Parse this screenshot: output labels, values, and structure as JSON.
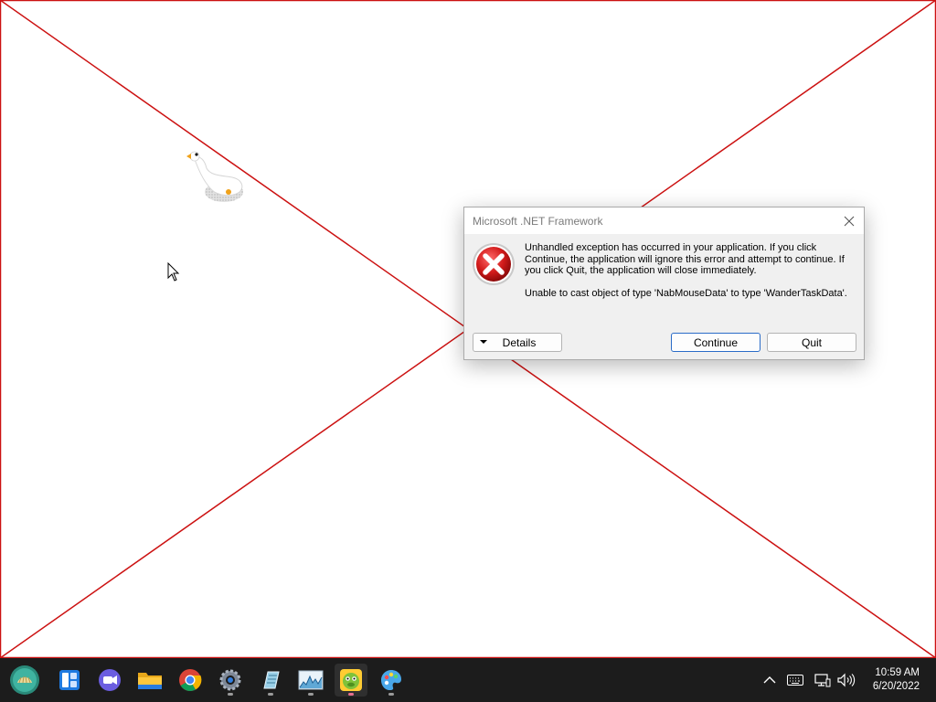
{
  "dialog": {
    "title": "Microsoft .NET Framework",
    "message": "Unhandled exception has occurred in your application. If you click Continue, the application will ignore this error and attempt to continue. If you click Quit, the application will close immediately.",
    "detail": "Unable to cast object of type 'NabMouseData' to type 'WanderTaskData'.",
    "buttons": {
      "details": "Details",
      "continue": "Continue",
      "quit": "Quit"
    },
    "icons": {
      "close": "close-icon",
      "error": "error-icon",
      "expand": "caret-down-icon"
    }
  },
  "taskbar": {
    "apps": [
      {
        "name": "start-button",
        "icon": "shell-orb-icon"
      },
      {
        "name": "widgets",
        "icon": "widgets-icon"
      },
      {
        "name": "chat",
        "icon": "chat-camera-icon"
      },
      {
        "name": "file-explorer",
        "icon": "folder-icon"
      },
      {
        "name": "chrome",
        "icon": "chrome-icon"
      },
      {
        "name": "settings",
        "icon": "gear-icon"
      },
      {
        "name": "notes",
        "icon": "notepad-icon"
      },
      {
        "name": "task-manager",
        "icon": "chart-icon"
      },
      {
        "name": "desktop-goose",
        "icon": "goose-icon"
      },
      {
        "name": "paint",
        "icon": "palette-icon"
      }
    ],
    "tray": [
      "chevron-up-icon",
      "keyboard-icon",
      "network-icon",
      "volume-icon"
    ],
    "clock": {
      "time": "10:59 AM",
      "date": "6/20/2022"
    }
  },
  "colors": {
    "desktop_bg": "#ffffff",
    "x_lines": "#cc1111",
    "taskbar_bg": "#1c1c1c",
    "dialog_bg": "#f0f0f0",
    "accent_border": "#2a6bc7",
    "error_red": "#d21b1b"
  }
}
